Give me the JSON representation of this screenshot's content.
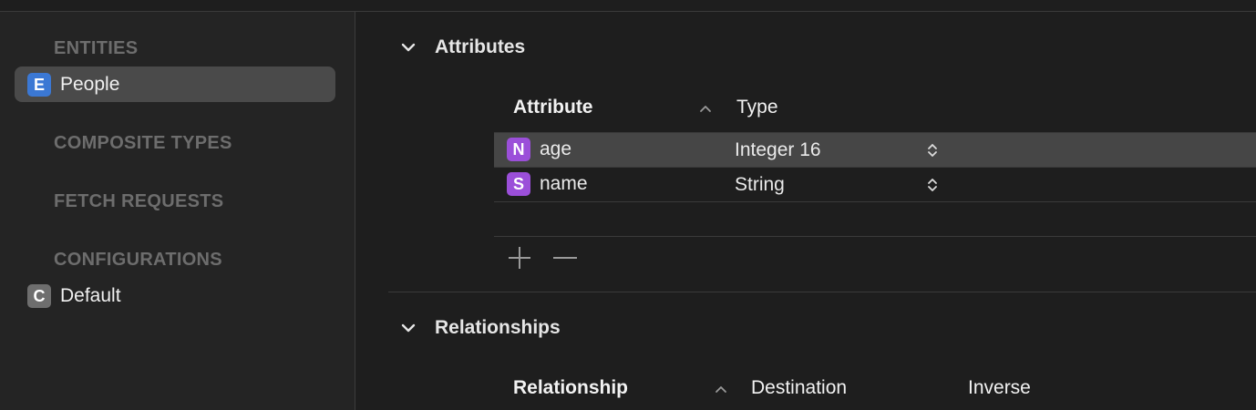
{
  "sidebar": {
    "entities_header": "ENTITIES",
    "entities": [
      {
        "badge": "E",
        "label": "People",
        "selected": true
      }
    ],
    "composite_types_header": "COMPOSITE TYPES",
    "fetch_requests_header": "FETCH REQUESTS",
    "configurations_header": "CONFIGURATIONS",
    "configurations": [
      {
        "badge": "C",
        "label": "Default"
      }
    ]
  },
  "attributes": {
    "title": "Attributes",
    "columns": {
      "attribute": "Attribute",
      "type": "Type"
    },
    "rows": [
      {
        "badge": "N",
        "name": "age",
        "type": "Integer 16",
        "selected": true
      },
      {
        "badge": "S",
        "name": "name",
        "type": "String",
        "selected": false
      }
    ],
    "add_icon": "plus-icon",
    "remove_icon": "minus-icon"
  },
  "relationships": {
    "title": "Relationships",
    "columns": {
      "relationship": "Relationship",
      "destination": "Destination",
      "inverse": "Inverse"
    }
  },
  "colors": {
    "background": "#1e1e1e",
    "sidebar": "#242424",
    "selection": "#4a4a4a",
    "entity_badge": "#3b78d4",
    "attribute_badge": "#9b4fd9",
    "config_badge": "#6e6e6e"
  }
}
